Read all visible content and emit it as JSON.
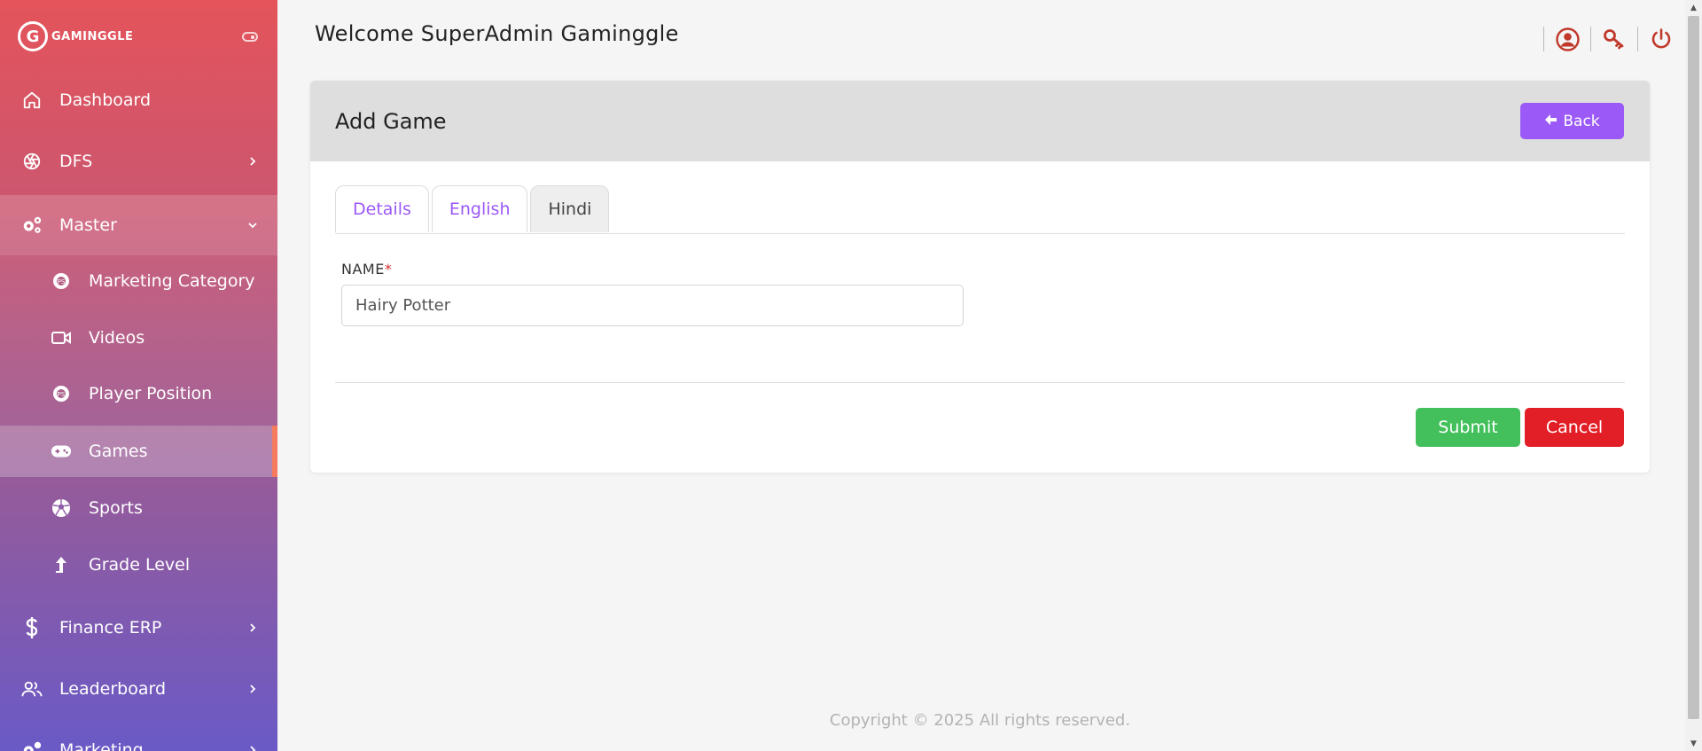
{
  "brand": {
    "logo_letter": "G",
    "name": "GAMINGGLE"
  },
  "header": {
    "welcome": "Welcome SuperAdmin Gaminggle"
  },
  "sidebar": {
    "items": [
      {
        "label": "Dashboard",
        "icon": "home-icon"
      },
      {
        "label": "DFS",
        "icon": "aperture-icon"
      },
      {
        "label": "Master",
        "icon": "gears-icon"
      },
      {
        "label": "Marketing Category",
        "icon": "badge-icon"
      },
      {
        "label": "Videos",
        "icon": "video-icon"
      },
      {
        "label": "Player Position",
        "icon": "badge-icon"
      },
      {
        "label": "Games",
        "icon": "gamepad-icon"
      },
      {
        "label": "Sports",
        "icon": "ball-icon"
      },
      {
        "label": "Grade Level",
        "icon": "arrow-up-icon"
      },
      {
        "label": "Finance ERP",
        "icon": "dollar-icon"
      },
      {
        "label": "Leaderboard",
        "icon": "users-icon"
      },
      {
        "label": "Marketing",
        "icon": "gears-icon"
      }
    ]
  },
  "card": {
    "title": "Add Game",
    "back_label": "Back",
    "tabs": [
      "Details",
      "English",
      "Hindi"
    ],
    "active_tab": "Hindi",
    "field_label": "NAME",
    "required_mark": "*",
    "name_value": "Hairy Potter",
    "submit_label": "Submit",
    "cancel_label": "Cancel"
  },
  "footer": {
    "text": "Copyright © 2025  All rights reserved."
  },
  "colors": {
    "accent": "#9b59f7",
    "submit": "#43c05c",
    "cancel": "#e21f26",
    "header_icons": "#c0392b"
  }
}
